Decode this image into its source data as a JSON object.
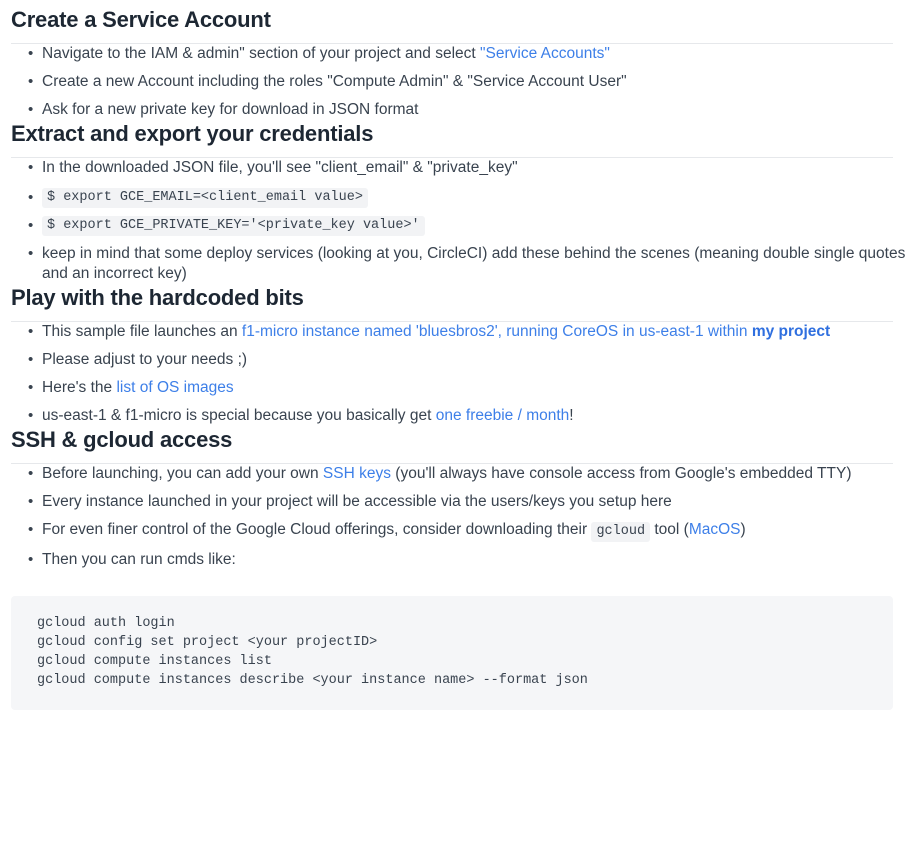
{
  "colors": {
    "body_text": "#39434f",
    "heading_text": "#1d2733",
    "link": "#3d7fe8",
    "link_bold": "#2f6fdf",
    "rule": "#e6e8eb",
    "inline_code_bg": "#f2f3f5",
    "code_block_bg": "#f5f6f8",
    "page_bg": "#ffffff"
  },
  "sections": [
    {
      "heading": "Create a Service Account",
      "bullets": [
        {
          "parts": [
            {
              "type": "text",
              "text": "Navigate to the IAM & admin\" section of your project and select "
            },
            {
              "type": "link",
              "text": "\"Service Accounts\""
            }
          ]
        },
        {
          "parts": [
            {
              "type": "text",
              "text": "Create a new Account including the roles \"Compute Admin\" & \"Service Account User\""
            }
          ]
        },
        {
          "parts": [
            {
              "type": "text",
              "text": "Ask for a new private key for download in JSON format"
            }
          ]
        }
      ]
    },
    {
      "heading": "Extract and export your credentials",
      "bullets": [
        {
          "parts": [
            {
              "type": "text",
              "text": "In the downloaded JSON file, you'll see \"client_email\" & \"private_key\""
            }
          ]
        },
        {
          "code_only": true,
          "parts": [
            {
              "type": "code",
              "text": "$ export GCE_EMAIL=<client_email value>"
            }
          ]
        },
        {
          "code_only": true,
          "parts": [
            {
              "type": "code",
              "text": "$ export GCE_PRIVATE_KEY='<private_key value>'"
            }
          ]
        },
        {
          "parts": [
            {
              "type": "text",
              "text": "keep in mind that some deploy services (looking at you, CircleCI) add these behind the scenes (meaning double single quotes and an incorrect key)"
            }
          ]
        }
      ]
    },
    {
      "heading": "Play with the hardcoded bits",
      "bullets": [
        {
          "parts": [
            {
              "type": "text",
              "text": "This sample file launches an "
            },
            {
              "type": "link",
              "text": "f1-micro instance named 'bluesbros2', running CoreOS in us-east-1 within "
            },
            {
              "type": "link-bold",
              "text": "my project"
            }
          ]
        },
        {
          "parts": [
            {
              "type": "text",
              "text": "Please adjust to your needs ;)"
            }
          ]
        },
        {
          "parts": [
            {
              "type": "text",
              "text": "Here's the "
            },
            {
              "type": "link",
              "text": "list of OS images"
            }
          ]
        },
        {
          "parts": [
            {
              "type": "text",
              "text": "us-east-1 & f1-micro is special because you basically get "
            },
            {
              "type": "link",
              "text": "one freebie / month"
            },
            {
              "type": "text",
              "text": "!"
            }
          ]
        }
      ]
    },
    {
      "heading": "SSH & gcloud access",
      "bullets": [
        {
          "parts": [
            {
              "type": "text",
              "text": "Before launching, you can add your own "
            },
            {
              "type": "link",
              "text": "SSH keys"
            },
            {
              "type": "text",
              "text": " (you'll always have console access from Google's embedded TTY)"
            }
          ]
        },
        {
          "parts": [
            {
              "type": "text",
              "text": "Every instance launched in your project will be accessible via the users/keys you setup here"
            }
          ]
        },
        {
          "parts": [
            {
              "type": "text",
              "text": "For even finer control of the Google Cloud offerings, consider downloading their "
            },
            {
              "type": "code",
              "text": "gcloud"
            },
            {
              "type": "text",
              "text": " tool ("
            },
            {
              "type": "link",
              "text": "MacOS"
            },
            {
              "type": "text",
              "text": ")"
            }
          ]
        },
        {
          "parts": [
            {
              "type": "text",
              "text": "Then you can run cmds like:"
            }
          ]
        }
      ],
      "code_block": "gcloud auth login\ngcloud config set project <your projectID>\ngcloud compute instances list\ngcloud compute instances describe <your instance name> --format json"
    }
  ]
}
